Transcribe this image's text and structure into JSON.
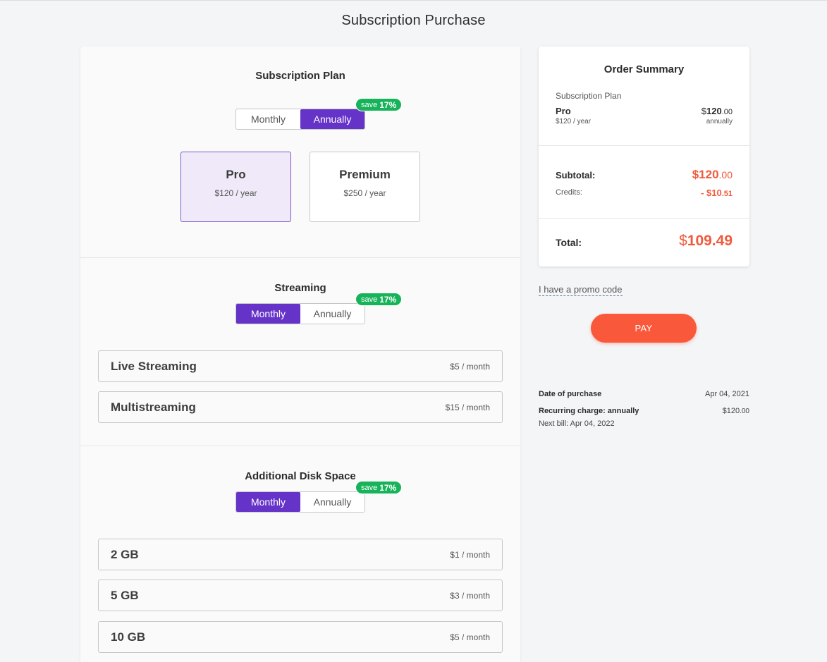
{
  "page_title": "Subscription Purchase",
  "plan_section": {
    "title": "Subscription Plan",
    "toggle": {
      "monthly": "Monthly",
      "annually": "Annually",
      "active": "annually"
    },
    "badge": {
      "prefix": "save",
      "value": "17%"
    },
    "plans": [
      {
        "name": "Pro",
        "price": "$120 / year",
        "selected": true
      },
      {
        "name": "Premium",
        "price": "$250 / year",
        "selected": false
      }
    ]
  },
  "streaming_section": {
    "title": "Streaming",
    "toggle": {
      "monthly": "Monthly",
      "annually": "Annually",
      "active": "monthly"
    },
    "badge": {
      "prefix": "save",
      "value": "17%"
    },
    "options": [
      {
        "name": "Live Streaming",
        "price": "$5 / month"
      },
      {
        "name": "Multistreaming",
        "price": "$15 / month"
      }
    ]
  },
  "disk_section": {
    "title": "Additional Disk Space",
    "toggle": {
      "monthly": "Monthly",
      "annually": "Annually",
      "active": "monthly"
    },
    "badge": {
      "prefix": "save",
      "value": "17%"
    },
    "options": [
      {
        "name": "2 GB",
        "price": "$1 / month"
      },
      {
        "name": "5 GB",
        "price": "$3 / month"
      },
      {
        "name": "10 GB",
        "price": "$5 / month"
      }
    ]
  },
  "summary": {
    "title": "Order Summary",
    "plan_label": "Subscription Plan",
    "plan_name": "Pro",
    "plan_sub": "$120 / year",
    "plan_price_currency": "$",
    "plan_price_main": "120",
    "plan_price_cents": ".00",
    "plan_period": "annually",
    "subtotal_label": "Subtotal:",
    "subtotal_main": "$120",
    "subtotal_cents": ".00",
    "credits_label": "Credits:",
    "credits_main": "- $10",
    "credits_cents": ".51",
    "total_label": "Total:",
    "total_currency": "$",
    "total_value": "109.49"
  },
  "promo_link": "I have a promo code",
  "pay_label": "PAY",
  "purchase_info": {
    "date_label": "Date of purchase",
    "date_value": "Apr 04, 2021",
    "recurring_label": "Recurring charge: annually",
    "recurring_main": "$120",
    "recurring_cents": ".00",
    "next_bill": "Next bill: Apr 04, 2022"
  },
  "colors": {
    "accent_purple": "#6533c8",
    "save_green": "#17b35a",
    "price_red": "#f05a3c",
    "pay_orange": "#f9583b"
  }
}
